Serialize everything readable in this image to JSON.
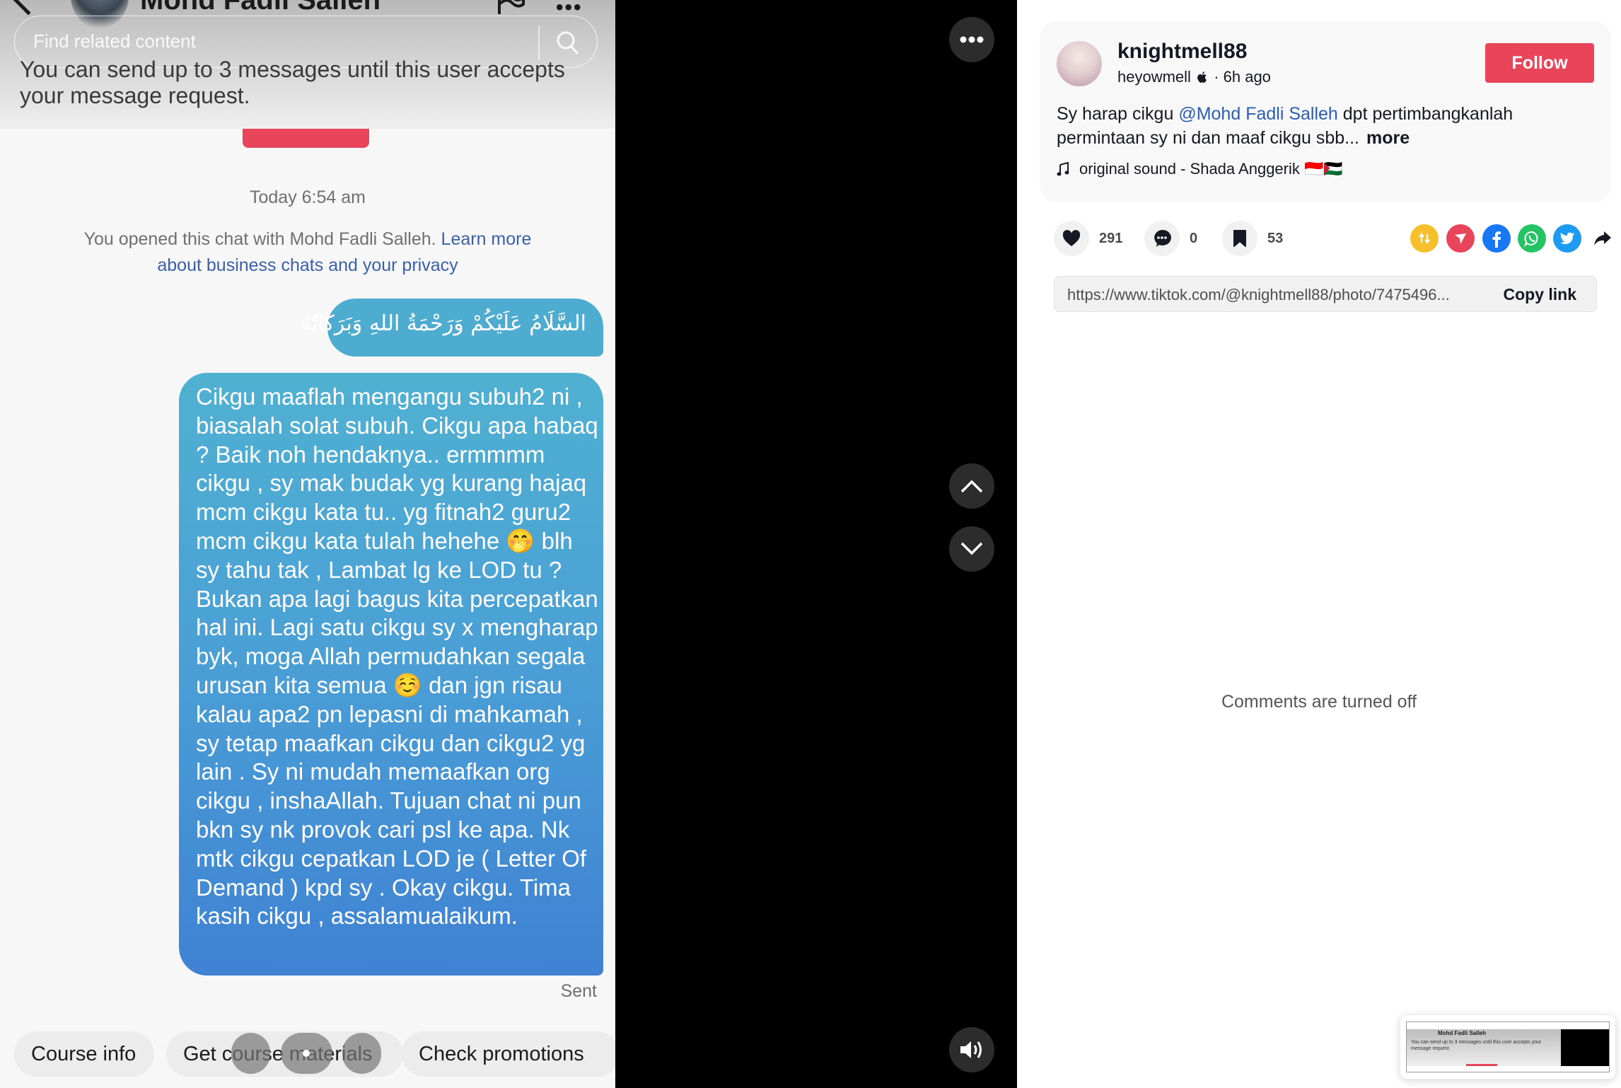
{
  "chat": {
    "contact_name": "Mohd Fadli Salleh",
    "find_placeholder": "Find related content",
    "request_note": "You can send up to 3 messages until this user accepts your message request.",
    "timestamp": "Today 6:54 am",
    "system_note_text": "You opened this chat with Mohd Fadli Salleh. ",
    "system_note_link": "Learn more about business chats and your privacy",
    "messages": [
      {
        "text": "السَّلَامُ عَلَيْكُمْ وَرَحْمَةُ اللهِ وَبَرَكَاتُهُ"
      },
      {
        "text": "Cikgu maaflah mengangu subuh2 ni , biasalah solat subuh. Cikgu apa habaq ? Baik noh hendaknya.. ermmmm cikgu , sy mak budak yg kurang hajaq mcm cikgu kata tu.. yg fitnah2 guru2 mcm cikgu kata tulah hehehe 🤭 blh sy tahu tak , Lambat lg ke LOD tu ? Bukan apa lagi bagus kita percepatkan hal ini. Lagi satu cikgu sy x mengharap byk, moga Allah permudahkan segala urusan kita semua ☺️ dan jgn risau kalau apa2 pn lepasni di mahkamah , sy tetap maafkan cikgu dan cikgu2 yg lain . Sy ni mudah memaafkan org cikgu , inshaAllah. Tujuan chat ni pun bkn sy nk provok cari psl ke apa. Nk mtk cikgu cepatkan LOD je ( Letter Of Demand ) kpd sy . Okay cikgu. Tima kasih cikgu , assalamualaikum."
      }
    ],
    "sent_label": "Sent",
    "quick_replies": [
      "Course info",
      "Get course materials",
      "Check promotions"
    ]
  },
  "media_controls": {
    "more_icon": "more-horizontal-icon",
    "prev_icon": "chevron-up-icon",
    "next_icon": "chevron-down-icon",
    "volume_icon": "volume-icon"
  },
  "post": {
    "author_username": "knightmell88",
    "author_nickname": "heyowmell",
    "author_badge_icon": "apple-icon",
    "posted_ago": "· 6h ago",
    "follow_label": "Follow",
    "caption_prefix": "Sy harap cikgu ",
    "caption_mention": "@Mohd Fadli Salleh",
    "caption_rest": " dpt pertimbangkanlah permintaan sy ni dan maaf cikgu sbb...",
    "caption_more": "more",
    "sound": "original sound - Shada Anggerik 🇮🇩🇵🇸",
    "likes": "291",
    "comments": "0",
    "saves": "53",
    "share_targets": [
      {
        "name": "repost",
        "color": "#f5c02c"
      },
      {
        "name": "send",
        "color": "#e8445a"
      },
      {
        "name": "facebook",
        "color": "#1877f2"
      },
      {
        "name": "whatsapp",
        "color": "#25c366"
      },
      {
        "name": "twitter",
        "color": "#1d9bf0"
      }
    ],
    "link_url": "https://www.tiktok.com/@knightmell88/photo/7475496...",
    "copy_link_label": "Copy link",
    "comments_off": "Comments are turned off"
  },
  "mini_preview": {
    "title": "Mohd Fadli Salleh",
    "text": "You can send up to 3 messages until this user accepts your message request."
  },
  "colors": {
    "accent": "#e8445a",
    "bubble_top": "#50b1d1",
    "bubble_bottom": "#3f82d4",
    "mention": "#2b5db0"
  }
}
